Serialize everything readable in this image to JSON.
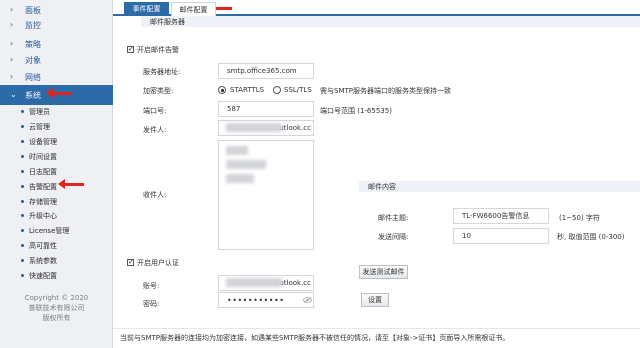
{
  "sidebar": {
    "items": [
      {
        "label": "面板"
      },
      {
        "label": "监控"
      },
      {
        "label": "策略"
      },
      {
        "label": "对象"
      },
      {
        "label": "网络"
      },
      {
        "label": "系统"
      }
    ],
    "subitems": [
      {
        "label": "管理员"
      },
      {
        "label": "云管理"
      },
      {
        "label": "设备管理"
      },
      {
        "label": "时间设置"
      },
      {
        "label": "日志配置"
      },
      {
        "label": "告警配置"
      },
      {
        "label": "存储管理"
      },
      {
        "label": "升级中心"
      },
      {
        "label": "License管理"
      },
      {
        "label": "高可靠性"
      },
      {
        "label": "系统参数"
      },
      {
        "label": "快速配置"
      }
    ],
    "copyright_line1": "Copyright © 2020",
    "copyright_line2": "普联技术有限公司",
    "copyright_line3": "版权所有"
  },
  "tabs": [
    {
      "label": "事件配置"
    },
    {
      "label": "邮件配置"
    }
  ],
  "mail_server": {
    "section_title": "邮件服务器",
    "enable_label": "开启邮件告警",
    "server_label": "服务器地址:",
    "server_value": "smtp.office365.com",
    "encrypt_label": "加密类型:",
    "encrypt_options": [
      "STARTTLS",
      "SSL/TLS"
    ],
    "encrypt_hint": "需与SMTP服务器端口的服务类型保持一致",
    "port_label": "端口号:",
    "port_value": "587",
    "port_hint": "端口号范围 (1-65535)",
    "sender_label": "发件人:",
    "sender_visible": "outlook.cc",
    "recipient_label": "收件人:",
    "auth_label": "开启用户认证",
    "account_label": "账号:",
    "account_visible": "outlook.cc",
    "password_label": "密码:",
    "password_value": "•••••••••••"
  },
  "mail_content": {
    "section_title": "邮件内容",
    "subject_label": "邮件主题:",
    "subject_value": "TL-FW6600告警信息",
    "subject_hint": "(1~50) 字符",
    "interval_label": "发送间隔:",
    "interval_value": "10",
    "interval_hint": "秒, 取值范围 (0-300)"
  },
  "buttons": {
    "test_mail": "发送测试邮件",
    "apply": "设置"
  },
  "notice": "当前与SMTP服务器的连接均为加密连接，如遇某些SMTP服务器不被信任的情况，请至【对象->证书】页面导入所需根证书。",
  "colors": {
    "accent": "#2d6aa8",
    "arrow": "#e0231c"
  }
}
